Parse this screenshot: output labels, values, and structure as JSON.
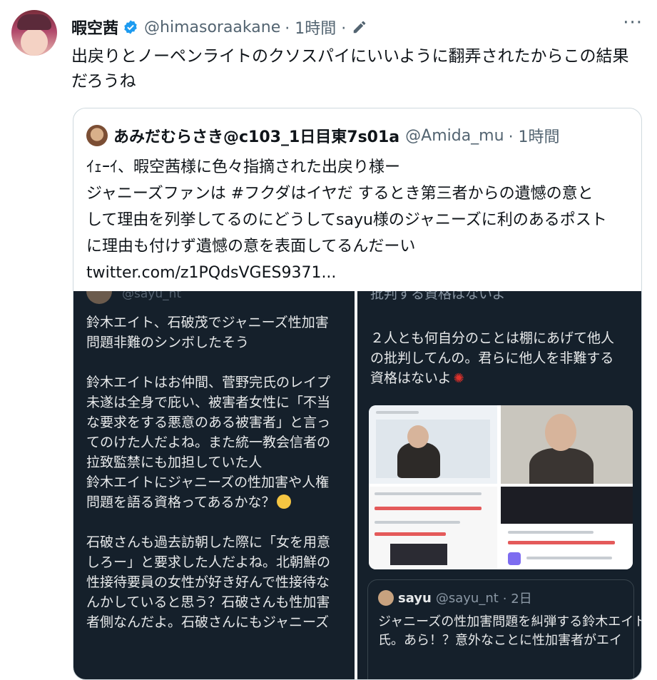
{
  "tweet": {
    "author_name": "暇空茜",
    "handle": "@himasoraakane",
    "time": "· 1時間 ·",
    "text_lines": [
      "出戻りとノーペンライトのクソスパイにいいように翻弄されたからこの結果",
      "だろうね"
    ],
    "icons": [
      "avatar",
      "verified-icon",
      "pencil-icon",
      "more-icon"
    ]
  },
  "quote": {
    "author_name": "あみだむらさき@c103_1日目東7s01a",
    "handle": "@Amida_mu",
    "time": "· 1時間",
    "text_lines": [
      "ｲｪｰｲ、暇空茜様に色々指摘された出戻り様ー",
      "ジャニーズファンは #フクダはイヤだ するとき第三者からの遺憾の意と",
      "して理由を列挙してるのにどうしてsayu様のジャニーズに利のあるポスト",
      "に理由も付けず遺憾の意を表面してるんだーい"
    ],
    "link": "twitter.com/z1PQdsVGES9371..."
  },
  "media_left": {
    "ghost_handle": "@sayu_nt",
    "blocks": [
      [
        "鈴木エイト、石破茂でジャニーズ性加害",
        "問題非難のシンボしたそう"
      ],
      [
        "鈴木エイトはお仲間、菅野完氏のレイプ",
        "未遂は全身で庇い、被害者女性に「不当",
        "な要求をする悪意のある被害者」と言っ",
        "てのけた人だよね。また統一教会信者の",
        "拉致監禁にも加担していた人",
        "鈴木エイトにジャニーズの性加害や人権",
        "問題を語る資格ってあるかな？"
      ],
      [
        "石破さんも過去訪朝した際に「女を用意",
        "しろー」と要求した人だよね。北朝鮮の",
        "性接待要員の女性が好き好んで性接待な",
        "んかしていると思う？石破さんも性加害",
        "者側なんだよ。石破さんにもジャニーズ"
      ]
    ]
  },
  "media_right": {
    "ghost_line": "批判する資格はないよ",
    "lines": [
      "２人とも何自分のことは棚にあげて他人",
      "の批判してんの。君らに他人を非難する",
      "資格はないよ"
    ],
    "embed": {
      "name": "sayu",
      "handle": "@sayu_nt",
      "time": "· 2日",
      "text_lines": [
        "ジャニーズの性加害問題を糾弾する鈴木エイト",
        "氏。あら！？意外なことに性加害者がエイ"
      ]
    }
  },
  "colors": {
    "accent": "#1d9bf0",
    "muted": "#536471",
    "dark_panel": "#15202b"
  }
}
